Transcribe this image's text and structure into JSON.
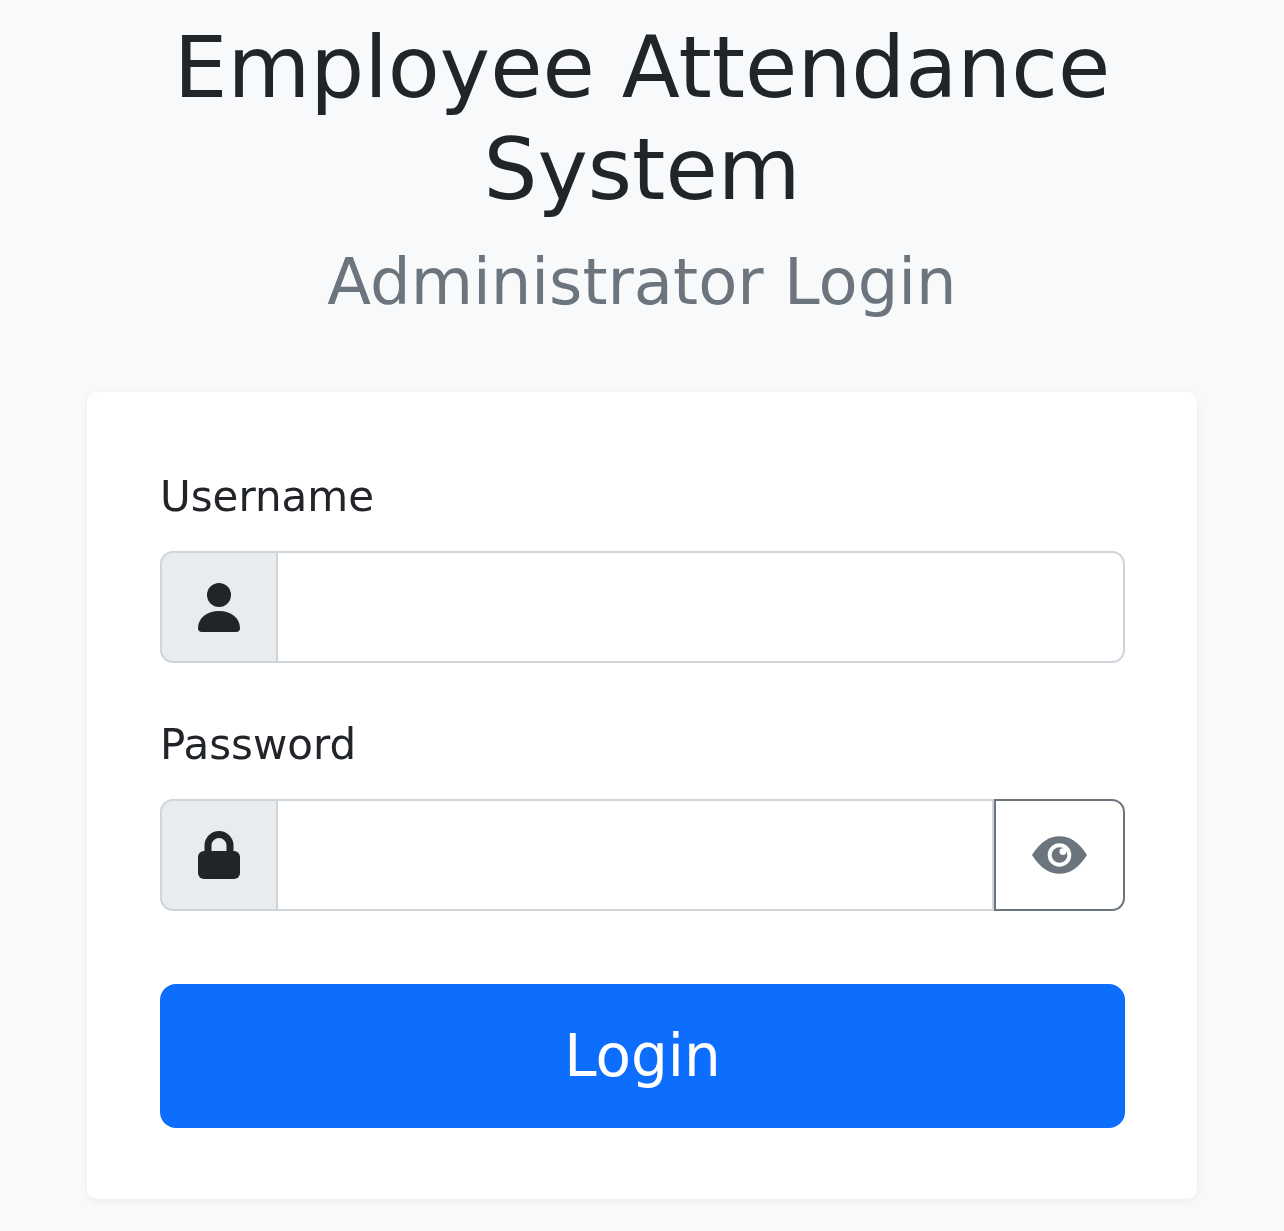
{
  "title": "Employee Attendance System",
  "subtitle": "Administrator Login",
  "login_form": {
    "fields": [
      {
        "kind": "username",
        "label": "Username"
      },
      {
        "kind": "password",
        "label": "Password"
      }
    ],
    "submit_button": {
      "label": "Login"
    }
  }
}
